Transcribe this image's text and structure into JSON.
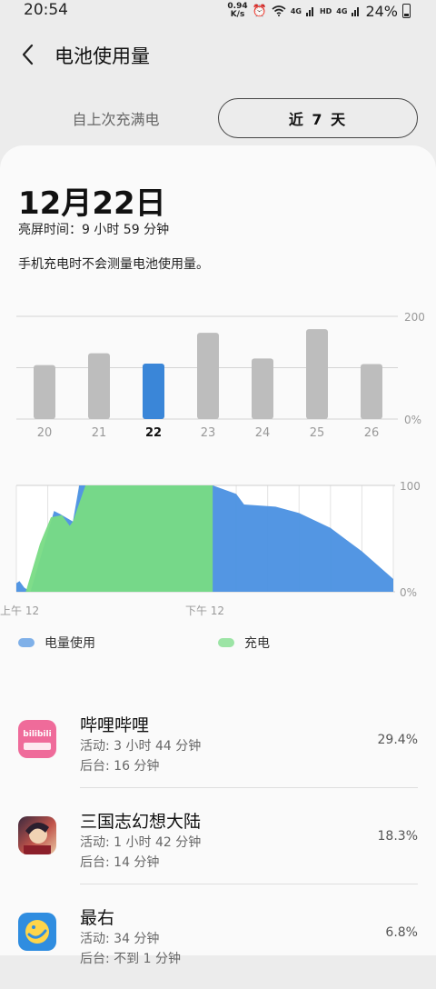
{
  "status_bar": {
    "time": "20:54",
    "net_speed_value": "0.94",
    "net_speed_unit": "K/s",
    "hd": "HD",
    "net1": "4G",
    "net2": "4G",
    "battery": "24%"
  },
  "header": {
    "title": "电池使用量",
    "back_icon": "chevron-left-icon"
  },
  "tabs": [
    {
      "label": "自上次充满电",
      "selected": false
    },
    {
      "label": "近 7 天",
      "selected": true
    }
  ],
  "summary": {
    "date": "12月22日",
    "screen_time": "亮屏时间：9 小时 59 分钟",
    "note": "手机充电时不会测量电池使用量。"
  },
  "legend": {
    "usage": "电量使用",
    "charging": "充电"
  },
  "colors": {
    "usage": "#4a90e2",
    "charging": "#78db84",
    "bar_default": "#bdbdbd",
    "bar_selected": "#3a86d8"
  },
  "chart_data": [
    {
      "type": "bar",
      "categories": [
        "20",
        "21",
        "22",
        "23",
        "24",
        "25",
        "26"
      ],
      "values": [
        105,
        128,
        108,
        168,
        118,
        175,
        107
      ],
      "selected": "22",
      "y_tick_labels": [
        "200",
        "0%"
      ],
      "ylim": [
        0,
        200
      ],
      "grid": true
    },
    {
      "type": "area",
      "x_tick_labels": [
        "上午 12",
        "下午 12"
      ],
      "y_tick_labels": [
        "100",
        "0%"
      ],
      "ylim": [
        0,
        100
      ],
      "xlim": [
        0,
        24
      ],
      "series": [
        {
          "name": "电量使用",
          "x": [
            0,
            0.2,
            0.5,
            0.9,
            2.4,
            2.8,
            3.6,
            4.0,
            4.4,
            12.5,
            14.0,
            14.5,
            16.5,
            18.0,
            20.0,
            22.0,
            24.0
          ],
          "y": [
            8,
            10,
            4,
            0,
            76,
            73,
            66,
            100,
            100,
            100,
            92,
            82,
            80,
            74,
            60,
            38,
            12
          ]
        },
        {
          "name": "充电",
          "x": [
            0.6,
            1.5,
            2.2,
            2.9,
            3.4,
            3.6,
            4.4,
            12.5
          ],
          "y": [
            0,
            45,
            70,
            72,
            62,
            66,
            100,
            100
          ]
        }
      ],
      "grid": true
    }
  ],
  "apps": [
    {
      "name": "哔哩哔哩",
      "active": "活动: 3 小时 44 分钟",
      "background": "后台: 16 分钟",
      "percent": "29.4%",
      "icon": "bilibili-icon",
      "icon_text": "bilibili"
    },
    {
      "name": "三国志幻想大陆",
      "active": "活动: 1 小时 42 分钟",
      "background": "后台: 14 分钟",
      "percent": "18.3%",
      "icon": "sanguo-game-icon"
    },
    {
      "name": "最右",
      "active": "活动: 34 分钟",
      "background": "后台: 不到 1 分钟",
      "percent": "6.8%",
      "icon": "zuiyou-icon"
    }
  ]
}
